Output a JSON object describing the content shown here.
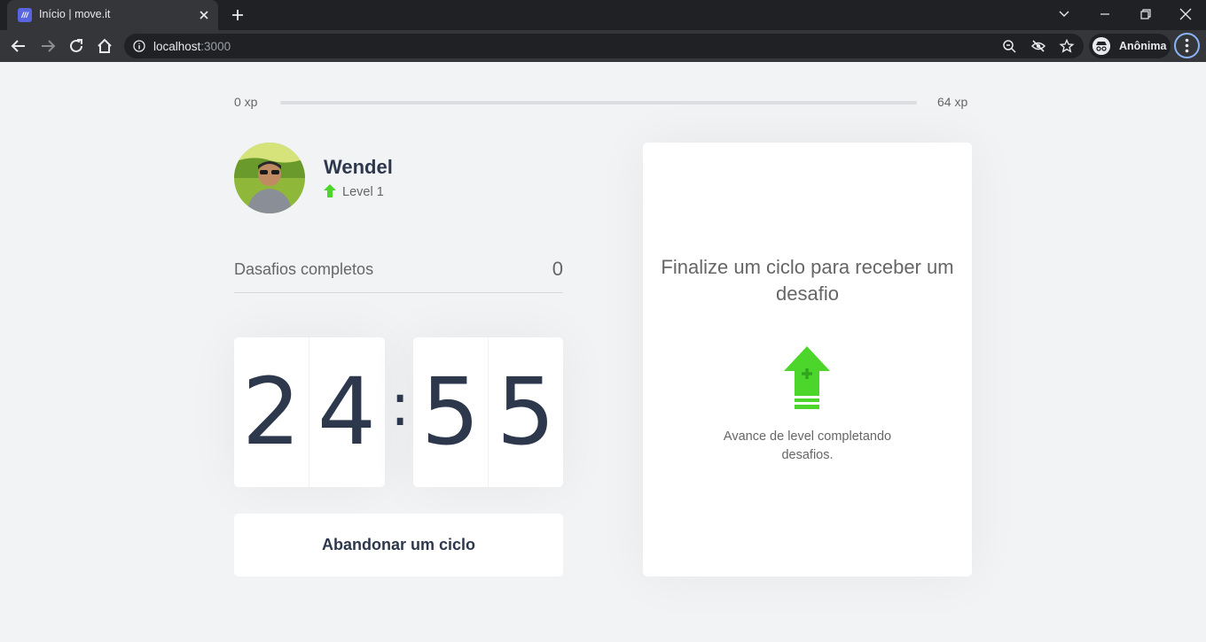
{
  "browser": {
    "tab_title": "Início | move.it",
    "favicon_text": "///",
    "url_host": "localhost",
    "url_port": ":3000",
    "profile_label": "Anônima"
  },
  "xp": {
    "min_label": "0 xp",
    "max_label": "64 xp",
    "current": 0,
    "max": 64
  },
  "profile": {
    "name": "Wendel",
    "level_label": "Level 1"
  },
  "challenges": {
    "label": "Dasafios completos",
    "count": "0"
  },
  "countdown": {
    "minute_left": "2",
    "minute_right": "4",
    "separator": ":",
    "second_left": "5",
    "second_right": "5"
  },
  "actions": {
    "abandon_label": "Abandonar um ciclo"
  },
  "challenge_box": {
    "title": "Finalize um ciclo para receber um desafio",
    "description": "Avance de level completando desafios."
  },
  "colors": {
    "accent_green": "#4cd62b",
    "title_dark": "#2e384d",
    "text_gray": "#666666",
    "background": "#f2f3f5"
  }
}
